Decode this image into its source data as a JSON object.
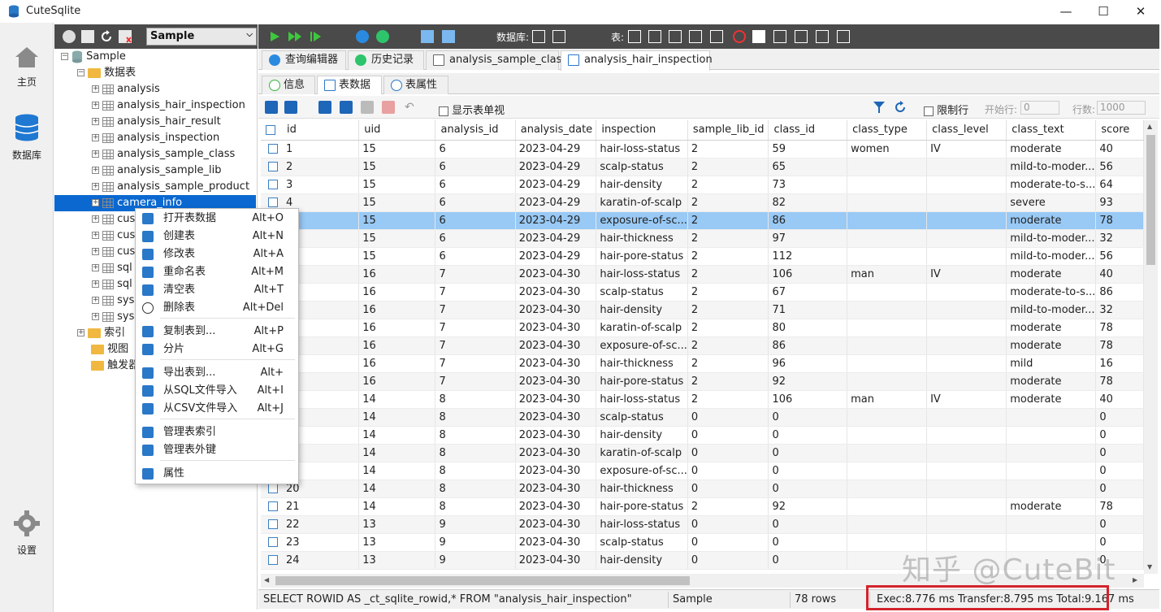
{
  "app": {
    "title": "CuteSqlite",
    "db_selected": "Sample"
  },
  "leftnav": [
    {
      "label": "主页",
      "icon": "home-icon"
    },
    {
      "label": "数据库",
      "icon": "database-icon"
    },
    {
      "label": "设置",
      "icon": "gear-icon"
    }
  ],
  "toolbar": {
    "db_label": "数据库:",
    "table_label": "表:"
  },
  "tree": {
    "root": "Sample",
    "tables_folder": "数据表",
    "tables": [
      "analysis",
      "analysis_hair_inspection",
      "analysis_hair_result",
      "analysis_inspection",
      "analysis_sample_class",
      "analysis_sample_lib",
      "analysis_sample_product",
      "camera_info",
      "cus",
      "cus",
      "cus",
      "sql",
      "sql",
      "sys",
      "sys"
    ],
    "other_folders": [
      "索引",
      "视图",
      "触发器"
    ]
  },
  "tabs": [
    {
      "label": "查询编辑器"
    },
    {
      "label": "历史记录"
    },
    {
      "label": "analysis_sample_class"
    },
    {
      "label": "analysis_hair_inspection"
    }
  ],
  "subtabs": [
    {
      "label": "信息"
    },
    {
      "label": "表数据"
    },
    {
      "label": "表属性"
    }
  ],
  "gridtool": {
    "show_form": "显示表单视",
    "limit": "限制行",
    "start_label": "开始行:",
    "start_val": "0",
    "rows_label": "行数:",
    "rows_val": "1000"
  },
  "context_menu": [
    {
      "label": "打开表数据",
      "key": "Alt+O"
    },
    {
      "label": "创建表",
      "key": "Alt+N"
    },
    {
      "label": "修改表",
      "key": "Alt+A"
    },
    {
      "label": "重命名表",
      "key": "Alt+M"
    },
    {
      "label": "清空表",
      "key": "Alt+T"
    },
    {
      "label": "删除表",
      "key": "Alt+Del"
    },
    {
      "label": "复制表到...",
      "key": "Alt+P"
    },
    {
      "label": "分片",
      "key": "Alt+G"
    },
    {
      "label": "导出表到...",
      "key": "Alt+"
    },
    {
      "label": "从SQL文件导入",
      "key": "Alt+I"
    },
    {
      "label": "从CSV文件导入",
      "key": "Alt+J"
    },
    {
      "label": "管理表索引",
      "key": ""
    },
    {
      "label": "管理表外键",
      "key": ""
    },
    {
      "label": "属性",
      "key": ""
    }
  ],
  "columns": [
    "id",
    "uid",
    "analysis_id",
    "analysis_date",
    "inspection",
    "sample_lib_id",
    "class_id",
    "class_type",
    "class_level",
    "class_text",
    "score"
  ],
  "rows": [
    [
      "1",
      "15",
      "6",
      "2023-04-29",
      "hair-loss-status",
      "2",
      "59",
      "women",
      "IV",
      "moderate",
      "40"
    ],
    [
      "2",
      "15",
      "6",
      "2023-04-29",
      "scalp-status",
      "2",
      "65",
      "",
      "",
      "mild-to-moder...",
      "56"
    ],
    [
      "3",
      "15",
      "6",
      "2023-04-29",
      "hair-density",
      "2",
      "73",
      "",
      "",
      "moderate-to-s...",
      "64"
    ],
    [
      "4",
      "15",
      "6",
      "2023-04-29",
      "karatin-of-scalp",
      "2",
      "82",
      "",
      "",
      "severe",
      "93"
    ],
    [
      "",
      "15",
      "6",
      "2023-04-29",
      "exposure-of-sc...",
      "2",
      "86",
      "",
      "",
      "moderate",
      "78"
    ],
    [
      "",
      "15",
      "6",
      "2023-04-29",
      "hair-thickness",
      "2",
      "97",
      "",
      "",
      "mild-to-moder...",
      "32"
    ],
    [
      "",
      "15",
      "6",
      "2023-04-29",
      "hair-pore-status",
      "2",
      "112",
      "",
      "",
      "mild-to-moder...",
      "56"
    ],
    [
      "",
      "16",
      "7",
      "2023-04-30",
      "hair-loss-status",
      "2",
      "106",
      "man",
      "IV",
      "moderate",
      "40"
    ],
    [
      "",
      "16",
      "7",
      "2023-04-30",
      "scalp-status",
      "2",
      "67",
      "",
      "",
      "moderate-to-s...",
      "86"
    ],
    [
      "",
      "16",
      "7",
      "2023-04-30",
      "hair-density",
      "2",
      "71",
      "",
      "",
      "mild-to-moder...",
      "32"
    ],
    [
      "",
      "16",
      "7",
      "2023-04-30",
      "karatin-of-scalp",
      "2",
      "80",
      "",
      "",
      "moderate",
      "78"
    ],
    [
      "",
      "16",
      "7",
      "2023-04-30",
      "exposure-of-sc...",
      "2",
      "86",
      "",
      "",
      "moderate",
      "78"
    ],
    [
      "",
      "16",
      "7",
      "2023-04-30",
      "hair-thickness",
      "2",
      "96",
      "",
      "",
      "mild",
      "16"
    ],
    [
      "",
      "16",
      "7",
      "2023-04-30",
      "hair-pore-status",
      "2",
      "92",
      "",
      "",
      "moderate",
      "78"
    ],
    [
      "",
      "14",
      "8",
      "2023-04-30",
      "hair-loss-status",
      "2",
      "106",
      "man",
      "IV",
      "moderate",
      "40"
    ],
    [
      "",
      "14",
      "8",
      "2023-04-30",
      "scalp-status",
      "0",
      "0",
      "",
      "",
      "",
      "0"
    ],
    [
      "",
      "14",
      "8",
      "2023-04-30",
      "hair-density",
      "0",
      "0",
      "",
      "",
      "",
      "0"
    ],
    [
      "",
      "14",
      "8",
      "2023-04-30",
      "karatin-of-scalp",
      "0",
      "0",
      "",
      "",
      "",
      "0"
    ],
    [
      "",
      "14",
      "8",
      "2023-04-30",
      "exposure-of-sc...",
      "0",
      "0",
      "",
      "",
      "",
      "0"
    ],
    [
      "20",
      "14",
      "8",
      "2023-04-30",
      "hair-thickness",
      "0",
      "0",
      "",
      "",
      "",
      "0"
    ],
    [
      "21",
      "14",
      "8",
      "2023-04-30",
      "hair-pore-status",
      "2",
      "92",
      "",
      "",
      "moderate",
      "78"
    ],
    [
      "22",
      "13",
      "9",
      "2023-04-30",
      "hair-loss-status",
      "0",
      "0",
      "",
      "",
      "",
      "0"
    ],
    [
      "23",
      "13",
      "9",
      "2023-04-30",
      "scalp-status",
      "0",
      "0",
      "",
      "",
      "",
      "0"
    ],
    [
      "24",
      "13",
      "9",
      "2023-04-30",
      "hair-density",
      "0",
      "0",
      "",
      "",
      "",
      "0"
    ]
  ],
  "status": {
    "sql": "SELECT ROWID AS _ct_sqlite_rowid,* FROM \"analysis_hair_inspection\"",
    "db": "Sample",
    "rows": "78 rows",
    "timing": "Exec:8.776 ms Transfer:8.795 ms Total:9.167 ms"
  },
  "watermark": "知乎 @CuteBit"
}
